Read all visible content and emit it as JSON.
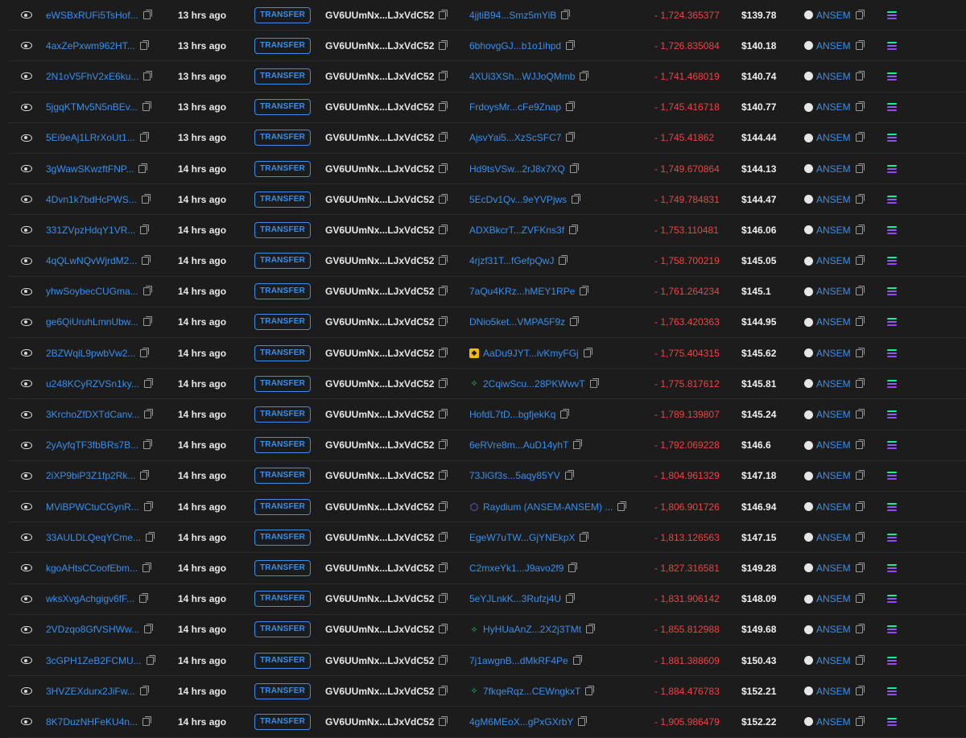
{
  "colors": {
    "link": "#3b8eea",
    "negative": "#ef4444",
    "background": "#1c1c1c"
  },
  "action_label": "TRANSFER",
  "token_label": "ANSEM",
  "from_address": "GV6UUmNx...LJxVdC52",
  "rows": [
    {
      "sig": "eWSBxRUFi5TsHof...",
      "time": "13 hrs ago",
      "to": "4jjtiB94...Smz5mYiB",
      "to_icon": "",
      "amount": "- 1,724.365377",
      "value": "$139.78"
    },
    {
      "sig": "4axZePxwm962HT...",
      "time": "13 hrs ago",
      "to": "6bhovgGJ...b1o1ihpd",
      "to_icon": "",
      "amount": "- 1,726.835084",
      "value": "$140.18"
    },
    {
      "sig": "2N1oV5FhV2xE6ku...",
      "time": "13 hrs ago",
      "to": "4XUi3XSh...WJJoQMmb",
      "to_icon": "",
      "amount": "- 1,741.468019",
      "value": "$140.74"
    },
    {
      "sig": "5jgqKTMv5N5nBEv...",
      "time": "13 hrs ago",
      "to": "FrdoysMr...cFe9Znap",
      "to_icon": "",
      "amount": "- 1,745.416718",
      "value": "$140.77"
    },
    {
      "sig": "5Ei9eAj1LRrXoUt1...",
      "time": "13 hrs ago",
      "to": "AjsvYai5...XzScSFC7",
      "to_icon": "",
      "amount": "- 1,745.41862",
      "value": "$144.44"
    },
    {
      "sig": "3gWawSKwzftFNP...",
      "time": "14 hrs ago",
      "to": "Hd9tsVSw...2rJ8x7XQ",
      "to_icon": "",
      "amount": "- 1,749.670864",
      "value": "$144.13"
    },
    {
      "sig": "4Dvn1k7bdHcPWS...",
      "time": "14 hrs ago",
      "to": "5EcDv1Qv...9eYVPjws",
      "to_icon": "",
      "amount": "- 1,749.784831",
      "value": "$144.47"
    },
    {
      "sig": "331ZVpzHdqY1VR...",
      "time": "14 hrs ago",
      "to": "ADXBkcrT...ZVFKns3f",
      "to_icon": "",
      "amount": "- 1,753.110481",
      "value": "$146.06"
    },
    {
      "sig": "4qQLwNQvWjrdM2...",
      "time": "14 hrs ago",
      "to": "4rjzf31T...fGefpQwJ",
      "to_icon": "",
      "amount": "- 1,758.700219",
      "value": "$145.05"
    },
    {
      "sig": "yhwSoybecCUGma...",
      "time": "14 hrs ago",
      "to": "7aQu4KRz...hMEY1RPe",
      "to_icon": "",
      "amount": "- 1,761.264234",
      "value": "$145.1"
    },
    {
      "sig": "ge6QiUruhLmnUbw...",
      "time": "14 hrs ago",
      "to": "DNio5ket...VMPA5F9z",
      "to_icon": "",
      "amount": "- 1,763.420363",
      "value": "$144.95"
    },
    {
      "sig": "2BZWqiL9pwbVw2...",
      "time": "14 hrs ago",
      "to": "AaDu9JYT...ivKmyFGj",
      "to_icon": "binance",
      "amount": "- 1,775.404315",
      "value": "$145.62"
    },
    {
      "sig": "u248KCyRZVSn1ky...",
      "time": "14 hrs ago",
      "to": "2CqiwScu...28PKWwvT",
      "to_icon": "star",
      "amount": "- 1,775.817612",
      "value": "$145.81"
    },
    {
      "sig": "3KrchoZfDXTdCanv...",
      "time": "14 hrs ago",
      "to": "HofdL7tD...bgfjekKq",
      "to_icon": "",
      "amount": "- 1,789.139807",
      "value": "$145.24"
    },
    {
      "sig": "2yAyfqTF3fbBRs7B...",
      "time": "14 hrs ago",
      "to": "6eRVre8m...AuD14yhT",
      "to_icon": "",
      "amount": "- 1,792.069228",
      "value": "$146.6"
    },
    {
      "sig": "2iXP9biP3Z1fp2Rk...",
      "time": "14 hrs ago",
      "to": "73JiGf3s...5aqy85YV",
      "to_icon": "",
      "amount": "- 1,804.961329",
      "value": "$147.18"
    },
    {
      "sig": "MViBPWCtuCGynR...",
      "time": "14 hrs ago",
      "to": "Raydium (ANSEM-ANSEM) ...",
      "to_icon": "raydium",
      "amount": "- 1,806.901726",
      "value": "$146.94"
    },
    {
      "sig": "33AULDLQeqYCme...",
      "time": "14 hrs ago",
      "to": "EgeW7uTW...GjYNEkpX",
      "to_icon": "",
      "amount": "- 1,813.126563",
      "value": "$147.15"
    },
    {
      "sig": "kgoAHtsCCoofEbm...",
      "time": "14 hrs ago",
      "to": "C2mxeYk1...J9avo2f9",
      "to_icon": "",
      "amount": "- 1,827.316581",
      "value": "$149.28"
    },
    {
      "sig": "wksXvgAchgigv6fF...",
      "time": "14 hrs ago",
      "to": "5eYJLnkK...3Rufzj4U",
      "to_icon": "",
      "amount": "- 1,831.906142",
      "value": "$148.09"
    },
    {
      "sig": "2VDzqo8GfVSHWw...",
      "time": "14 hrs ago",
      "to": "HyHUaAnZ...2X2j3TMt",
      "to_icon": "star",
      "amount": "- 1,855.812988",
      "value": "$149.68"
    },
    {
      "sig": "3cGPH1ZeB2FCMU...",
      "time": "14 hrs ago",
      "to": "7j1awgnB...dMkRF4Pe",
      "to_icon": "",
      "amount": "- 1,881.388609",
      "value": "$150.43"
    },
    {
      "sig": "3HVZEXdurx2JiFw...",
      "time": "14 hrs ago",
      "to": "7fkqeRqz...CEWngkxT",
      "to_icon": "star",
      "amount": "- 1,884.476783",
      "value": "$152.21"
    },
    {
      "sig": "8K7DuzNHFeKU4n...",
      "time": "14 hrs ago",
      "to": "4gM6MEoX...gPxGXrbY",
      "to_icon": "",
      "amount": "- 1,905.986479",
      "value": "$152.22"
    }
  ]
}
